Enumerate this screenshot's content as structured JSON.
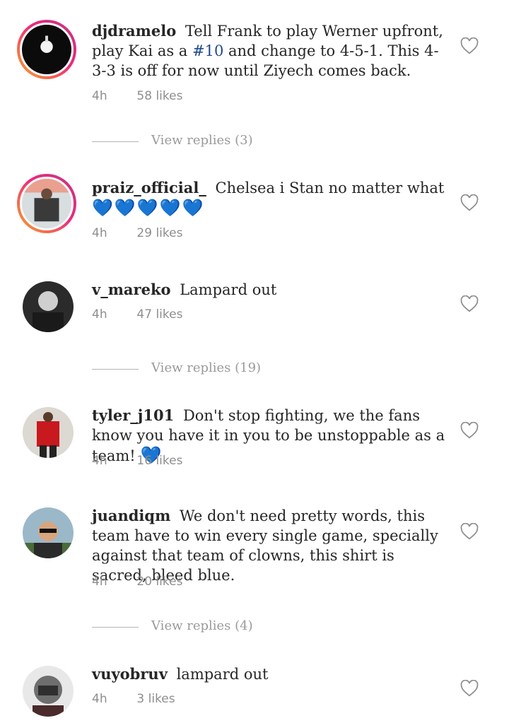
{
  "comments": [
    {
      "username": "djdramelo",
      "text_before": "Tell Frank to play Werner upfront, play Kai as a",
      "hashtag": "#10",
      "text_after": "and change to 4-5-1. This 4-3-3 is off for now until Ziyech comes back.",
      "time": "4h",
      "likes": "58 likes",
      "replies": "View replies (3)"
    },
    {
      "username": "praiz_official_",
      "text": "Chelsea i Stan no matter what",
      "emoji": "💙💙💙💙💙",
      "time": "4h",
      "likes": "29 likes"
    },
    {
      "username": "v_mareko",
      "text": "Lampard out",
      "time": "4h",
      "likes": "47 likes",
      "replies": "View replies (19)"
    },
    {
      "username": "tyler_j101",
      "text": "Don't stop fighting, we the fans know you have it in you to be unstoppable as a team!",
      "emoji": "💙",
      "time": "4h",
      "likes": "16 likes"
    },
    {
      "username": "juandiqm",
      "text": "We don't need pretty words, this team have to win every single game, specially against that team of clowns, this shirt is sacred, bleed blue.",
      "time": "4h",
      "likes": "20 likes",
      "replies": "View replies (4)"
    },
    {
      "username": "vuyobruv",
      "text": "lampard out",
      "time": "4h",
      "likes": "3 likes"
    }
  ],
  "colors": {
    "accent_hashtag": "#1f4b8c",
    "muted": "#8e8e8e",
    "emoji_heart": "#3db0e3",
    "story_ring": "#ee2a7b"
  },
  "icons": {
    "like": "heart-outline-icon"
  }
}
